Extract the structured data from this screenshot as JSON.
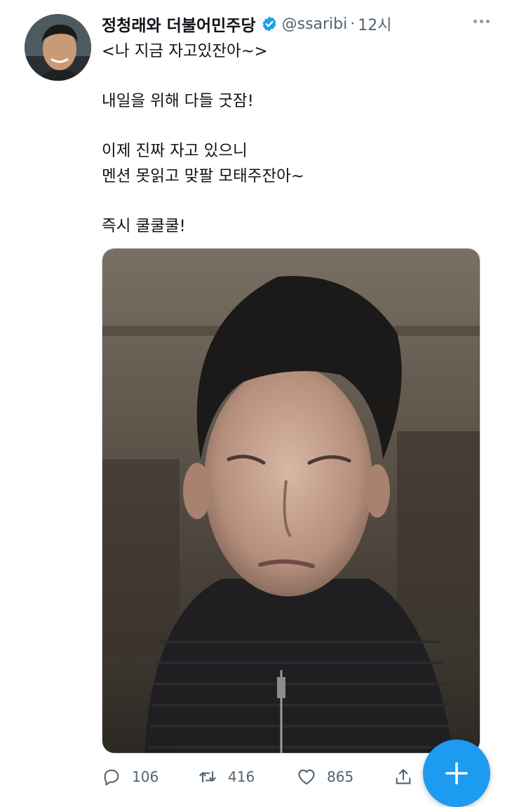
{
  "tweet": {
    "author_name": "정청래와 더불어민주당",
    "handle": "@ssaribi",
    "separator": "·",
    "time": "12시",
    "verified": true,
    "lines": [
      "<나 지금 자고있잔아~>",
      "",
      "내일을 위해 다들 굿잠!",
      "",
      "이제 진짜 자고 있으니",
      "멘션 못읽고 맞팔 모태주잔아~",
      "",
      "즉시 쿨쿨쿨!"
    ]
  },
  "actions": {
    "reply_count": "106",
    "retweet_count": "416",
    "like_count": "865"
  },
  "colors": {
    "accent": "#1d9bf0",
    "secondary_text": "#536471"
  },
  "icons": [
    "verified-badge-icon",
    "more-icon",
    "reply-icon",
    "retweet-icon",
    "like-icon",
    "share-icon",
    "compose-plus-icon"
  ]
}
